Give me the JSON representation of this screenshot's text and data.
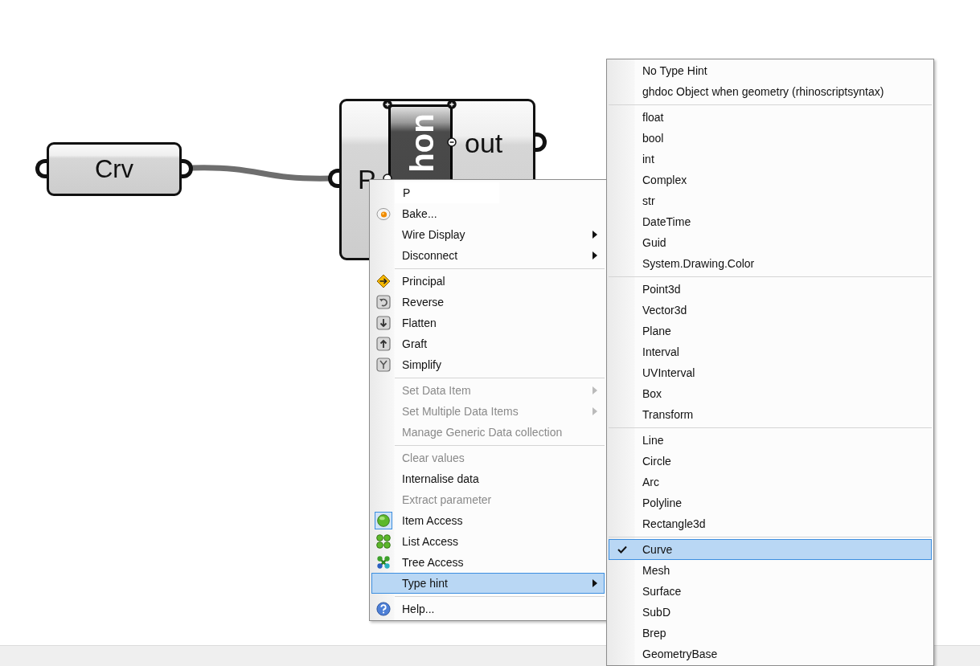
{
  "canvas": {
    "nodes": [
      {
        "kind": "param",
        "label": "Crv"
      },
      {
        "kind": "script",
        "title": "hon",
        "input": "P",
        "output": "out"
      }
    ]
  },
  "context_menu": {
    "name_field": {
      "value": "P"
    },
    "sections": [
      {
        "items": [
          {
            "label": "Bake...",
            "submenu": false,
            "disabled": false,
            "checked": false,
            "selected": false
          },
          {
            "label": "Wire Display",
            "submenu": true,
            "disabled": false,
            "checked": false,
            "selected": false
          },
          {
            "label": "Disconnect",
            "submenu": true,
            "disabled": false,
            "checked": false,
            "selected": false
          }
        ]
      },
      {
        "items": [
          {
            "label": "Principal",
            "submenu": false,
            "disabled": false,
            "checked": false,
            "selected": false
          },
          {
            "label": "Reverse",
            "submenu": false,
            "disabled": false,
            "checked": false,
            "selected": false
          },
          {
            "label": "Flatten",
            "submenu": false,
            "disabled": false,
            "checked": false,
            "selected": false
          },
          {
            "label": "Graft",
            "submenu": false,
            "disabled": false,
            "checked": false,
            "selected": false
          },
          {
            "label": "Simplify",
            "submenu": false,
            "disabled": false,
            "checked": false,
            "selected": false
          }
        ]
      },
      {
        "items": [
          {
            "label": "Set Data Item",
            "submenu": true,
            "disabled": true,
            "checked": false,
            "selected": false
          },
          {
            "label": "Set Multiple Data Items",
            "submenu": true,
            "disabled": true,
            "checked": false,
            "selected": false
          },
          {
            "label": "Manage Generic Data collection",
            "submenu": false,
            "disabled": true,
            "checked": false,
            "selected": false
          }
        ]
      },
      {
        "items": [
          {
            "label": "Clear values",
            "submenu": false,
            "disabled": true,
            "checked": false,
            "selected": false
          },
          {
            "label": "Internalise data",
            "submenu": false,
            "disabled": false,
            "checked": false,
            "selected": false
          },
          {
            "label": "Extract parameter",
            "submenu": false,
            "disabled": true,
            "checked": false,
            "selected": false
          },
          {
            "label": "Item Access",
            "submenu": false,
            "disabled": false,
            "checked": true,
            "selected": false
          },
          {
            "label": "List Access",
            "submenu": false,
            "disabled": false,
            "checked": false,
            "selected": false
          },
          {
            "label": "Tree Access",
            "submenu": false,
            "disabled": false,
            "checked": false,
            "selected": false
          },
          {
            "label": "Type hint",
            "submenu": true,
            "disabled": false,
            "checked": false,
            "selected": true
          }
        ]
      },
      {
        "items": [
          {
            "label": "Help...",
            "submenu": false,
            "disabled": false,
            "checked": false,
            "selected": false
          }
        ]
      }
    ]
  },
  "type_hint_menu": {
    "sections": [
      {
        "items": [
          {
            "label": "No Type Hint",
            "checked": false,
            "selected": false
          },
          {
            "label": "ghdoc Object when geometry (rhinoscriptsyntax)",
            "checked": false,
            "selected": false
          }
        ]
      },
      {
        "items": [
          {
            "label": "float",
            "checked": false,
            "selected": false
          },
          {
            "label": "bool",
            "checked": false,
            "selected": false
          },
          {
            "label": "int",
            "checked": false,
            "selected": false
          },
          {
            "label": "Complex",
            "checked": false,
            "selected": false
          },
          {
            "label": "str",
            "checked": false,
            "selected": false
          },
          {
            "label": "DateTime",
            "checked": false,
            "selected": false
          },
          {
            "label": "Guid",
            "checked": false,
            "selected": false
          },
          {
            "label": "System.Drawing.Color",
            "checked": false,
            "selected": false
          }
        ]
      },
      {
        "items": [
          {
            "label": "Point3d",
            "checked": false,
            "selected": false
          },
          {
            "label": "Vector3d",
            "checked": false,
            "selected": false
          },
          {
            "label": "Plane",
            "checked": false,
            "selected": false
          },
          {
            "label": "Interval",
            "checked": false,
            "selected": false
          },
          {
            "label": "UVInterval",
            "checked": false,
            "selected": false
          },
          {
            "label": "Box",
            "checked": false,
            "selected": false
          },
          {
            "label": "Transform",
            "checked": false,
            "selected": false
          }
        ]
      },
      {
        "items": [
          {
            "label": "Line",
            "checked": false,
            "selected": false
          },
          {
            "label": "Circle",
            "checked": false,
            "selected": false
          },
          {
            "label": "Arc",
            "checked": false,
            "selected": false
          },
          {
            "label": "Polyline",
            "checked": false,
            "selected": false
          },
          {
            "label": "Rectangle3d",
            "checked": false,
            "selected": false
          }
        ]
      },
      {
        "items": [
          {
            "label": "Curve",
            "checked": true,
            "selected": true
          },
          {
            "label": "Mesh",
            "checked": false,
            "selected": false
          },
          {
            "label": "Surface",
            "checked": false,
            "selected": false
          },
          {
            "label": "SubD",
            "checked": false,
            "selected": false
          },
          {
            "label": "Brep",
            "checked": false,
            "selected": false
          },
          {
            "label": "GeometryBase",
            "checked": false,
            "selected": false
          }
        ]
      }
    ]
  }
}
